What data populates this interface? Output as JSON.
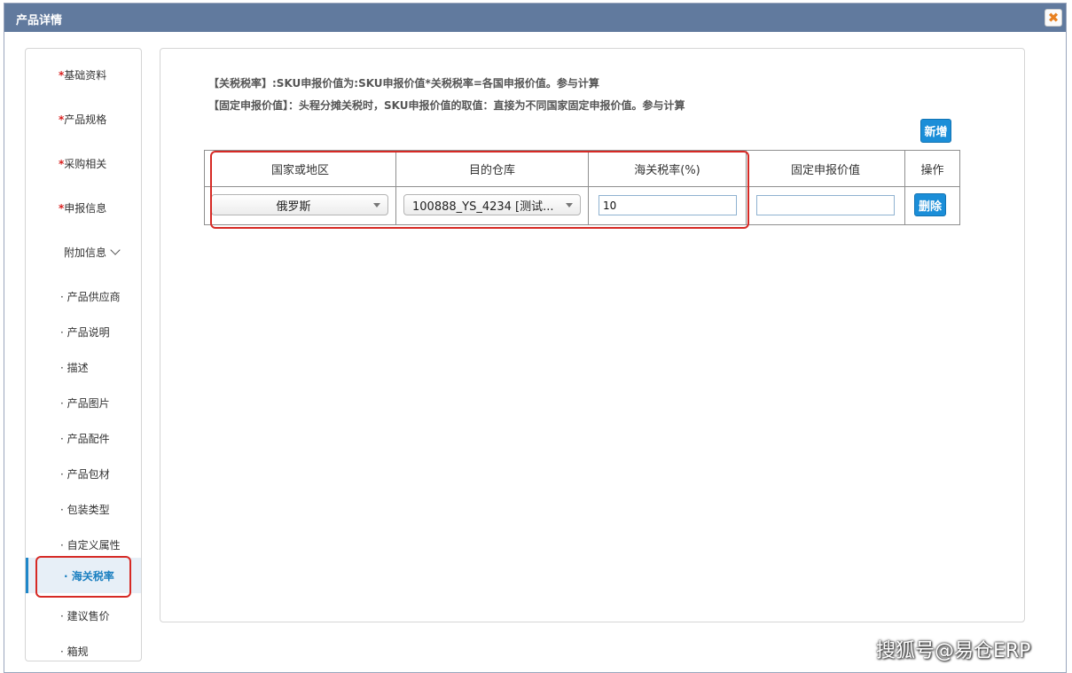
{
  "dialog": {
    "title": "产品详情",
    "close_icon": "close-icon",
    "accent_color": "#617a9e"
  },
  "sidebar": {
    "required_items": [
      {
        "mark": "*",
        "label": "基础资料"
      },
      {
        "mark": "*",
        "label": "产品规格"
      },
      {
        "mark": "*",
        "label": "采购相关"
      },
      {
        "mark": "*",
        "label": "申报信息"
      }
    ],
    "group_label": "附加信息",
    "group_icon": "chevron-down-icon",
    "sub_items": [
      "· 产品供应商",
      "· 产品说明",
      "· 描述",
      "· 产品图片",
      "· 产品配件",
      "· 产品包材",
      "· 包装类型",
      "· 自定义属性",
      "· 海关税率",
      "· 建议售价",
      "· 箱规"
    ],
    "active_item": "· 海关税率",
    "active_color": "#1a7fc0"
  },
  "content": {
    "note1": "【关税税率】:SKU申报价值为:SKU申报价值*关税税率=各国申报价值。参与计算",
    "note2": "【固定申报价值】：头程分摊关税时，SKU申报价值的取值：直接为不同国家固定申报价值。参与计算",
    "add_button": "新增",
    "table": {
      "headers": [
        "国家或地区",
        "目的仓库",
        "海关税率(%)",
        "固定申报价值",
        "操作"
      ],
      "rows": [
        {
          "country": "俄罗斯",
          "warehouse": "100888_YS_4234 [测试...",
          "rate": "10",
          "fixed_value": "",
          "delete_label": "删除"
        }
      ]
    },
    "button_color": "#1b8ed8",
    "highlight_color": "#d62a25"
  },
  "watermark": "搜狐号@易仓ERP"
}
